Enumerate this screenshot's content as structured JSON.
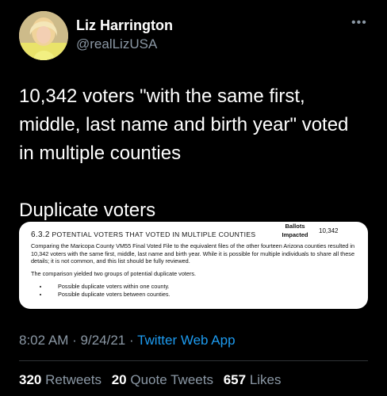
{
  "author": {
    "name": "Liz Harrington",
    "handle": "@realLizUSA"
  },
  "tweet": {
    "text": "10,342 voters \"with the same first,\nmiddle, last name and birth year\" voted\nin multiple counties\n\nDuplicate voters"
  },
  "card": {
    "section_number": "6.3.2",
    "section_title": "Potential Voters that Voted in Multiple Counties",
    "ballots_label": "Ballots",
    "impacted_label": "Impacted",
    "ballots_value": "10,342",
    "paragraph1": "Comparing the Maricopa County VM55 Final Voted File to the equivalent files of the other fourteen Arizona counties resulted in 10,342 voters with the same first, middle, last name and birth year. While it is possible for multiple individuals to share all these details; it is not common, and this list should be fully reviewed.",
    "paragraph2": "The comparison yielded two groups of potential duplicate voters.",
    "bullets": [
      "Possible duplicate voters within one county.",
      "Possible duplicate voters between counties."
    ]
  },
  "meta": {
    "time": "8:02 AM",
    "date": "9/24/21",
    "separator": "·",
    "app": "Twitter Web App"
  },
  "stats": {
    "retweets_count": "320",
    "retweets_label": "Retweets",
    "quotes_count": "20",
    "quotes_label": "Quote Tweets",
    "likes_count": "657",
    "likes_label": "Likes"
  },
  "colors": {
    "background": "#000000",
    "link": "#1d9bf0",
    "muted": "#8b98a5"
  },
  "icons": [
    "more-icon",
    "avatar"
  ]
}
